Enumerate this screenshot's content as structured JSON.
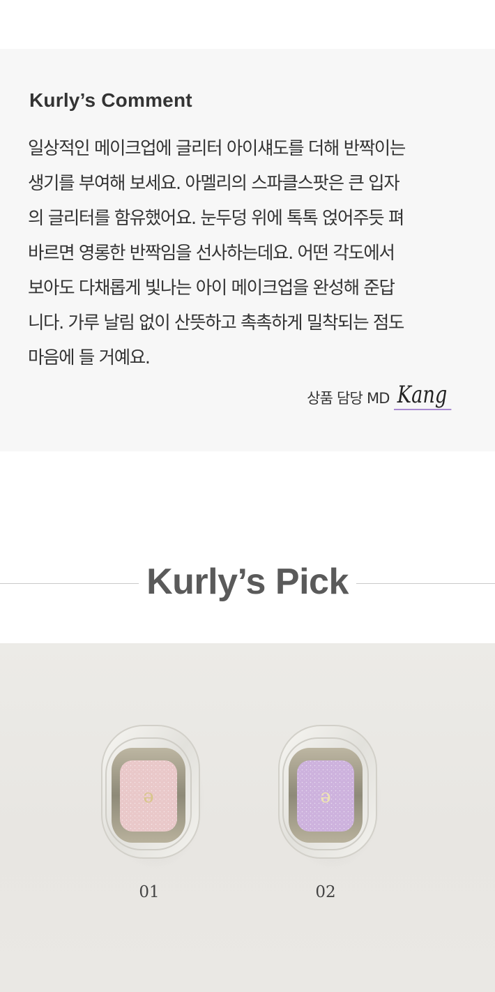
{
  "comment": {
    "title": "Kurly’s Comment",
    "lines": [
      "일상적인 메이크업에 글리터 아이섀도를 더해 반짝이는",
      "생기를 부여해 보세요. 아멜리의 스파클스팟은 큰 입자",
      "의 글리터를 함유했어요. 눈두덩 위에 톡톡 얹어주듯 펴",
      "바르면 영롱한 반짝임을 선사하는데요. 어떤 각도에서",
      "보아도 다채롭게 빛나는 아이 메이크업을 완성해 준답",
      "니다. 가루 날림 없이 산뜻하고 촉촉하게 밀착되는 점도",
      "마음에 들 거예요."
    ],
    "md_label": "상품 담당 MD",
    "md_signature": "Kang"
  },
  "pick": {
    "title": "Kurly’s Pick"
  },
  "products": [
    {
      "label": "01",
      "shade_color": "#e9c8c9",
      "logo_glyph": "ə"
    },
    {
      "label": "02",
      "shade_color": "#cdb2dd",
      "logo_glyph": "ə"
    }
  ],
  "colors": {
    "comment_bg": "#f7f7f7",
    "signature_underline": "#a889d0",
    "photo_bg": "#ebe9e5"
  }
}
